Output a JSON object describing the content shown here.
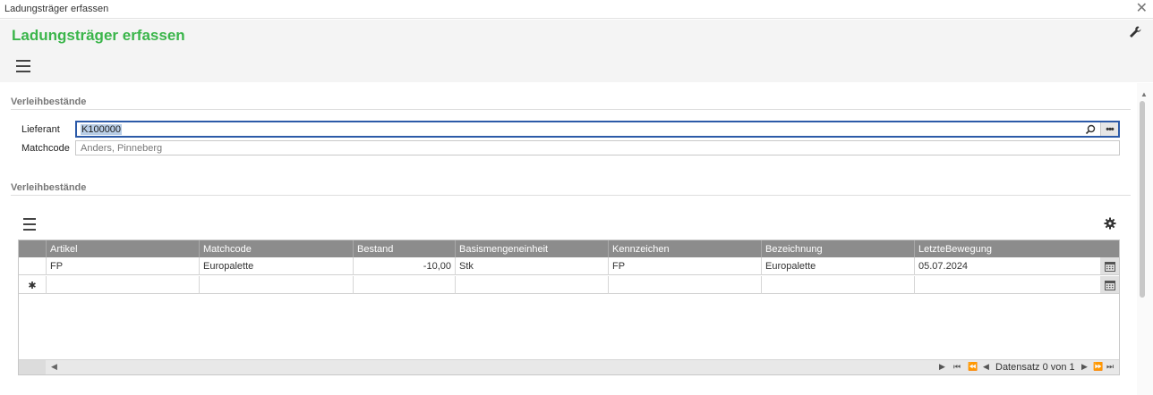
{
  "window": {
    "title": "Ladungsträger erfassen",
    "close_symbol": "✕"
  },
  "header": {
    "title": "Ladungsträger erfassen",
    "wrench_icon": "wrench-icon",
    "menu_icon": "hamburger-icon"
  },
  "section1": {
    "title": "Verleihbestände",
    "lieferant_label": "Lieferant",
    "lieferant_value": "K100000",
    "matchcode_label": "Matchcode",
    "matchcode_value": "Anders, Pinneberg",
    "more_symbol": "•••"
  },
  "section2": {
    "title": "Verleihbestände"
  },
  "grid": {
    "columns": [
      "Artikel",
      "Matchcode",
      "Bestand",
      "Basismengeneinheit",
      "Kennzeichen",
      "Bezeichnung",
      "LetzteBewegung"
    ],
    "rows": [
      {
        "artikel": "FP",
        "matchcode": "Europalette",
        "bestand": "-10,00",
        "einheit": "Stk",
        "kennzeichen": "FP",
        "bezeichnung": "Europalette",
        "letzte": "05.07.2024"
      }
    ],
    "new_row_marker": "✱",
    "navigator": {
      "text": "Datensatz 0 von 1",
      "first": "⏮",
      "prev_page": "⏪",
      "prev": "◀",
      "next": "▶",
      "next_page": "⏩",
      "last": "⏭",
      "left_arrow": "◀",
      "right_arrow": "▶"
    }
  },
  "colors": {
    "title_green": "#3ab54a",
    "header_bg": "#f4f4f4",
    "grid_header_bg": "#8c8c8c",
    "focus_border": "#2c5aa8",
    "selection_bg": "#b8cde6"
  }
}
